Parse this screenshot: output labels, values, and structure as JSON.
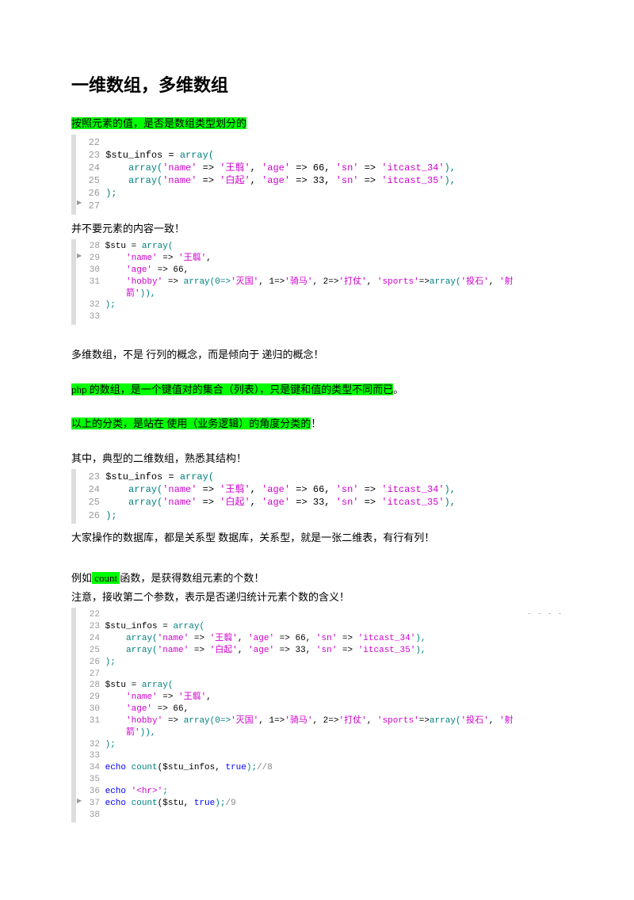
{
  "title": "一维数组，多维数组",
  "p1_hl": "按照元素的值，是否是数组类型划分的",
  "code1": {
    "l22": "22",
    "l23a": "23",
    "l23b": "$stu_infos = ",
    "l23c": "array",
    "l23d": "(",
    "l24a": "24",
    "l24b": "array",
    "l24c": "(",
    "l24d": "'name'",
    "l24e": " => ",
    "l24f": "'王翦'",
    "l24g": ", ",
    "l24h": "'age'",
    "l24i": " => 66, ",
    "l24j": "'sn'",
    "l24k": " => ",
    "l24l": "'itcast_34'",
    "l24m": "),",
    "l25a": "25",
    "l25b": "array",
    "l25c": "(",
    "l25d": "'name'",
    "l25e": " => ",
    "l25f": "'白起'",
    "l25g": ", ",
    "l25h": "'age'",
    "l25i": " => 33, ",
    "l25j": "'sn'",
    "l25k": " => ",
    "l25l": "'itcast_35'",
    "l25m": "),",
    "l26a": "26",
    "l26b": ");",
    "l27": "27"
  },
  "p2": "并不要元素的内容一致！",
  "code2": {
    "l28a": "28",
    "l28b": "$stu = ",
    "l28c": "array",
    "l28d": "(",
    "l29a": "29",
    "l29b": "'name'",
    "l29c": " => ",
    "l29d": "'王翦'",
    "l29e": ",",
    "l30a": "30",
    "l30b": "'age'",
    "l30c": " => 66,",
    "l31a": "31",
    "l31b": "'hobby'",
    "l31c": " => ",
    "l31d": "array",
    "l31e": "(0=>",
    "l31f": "'灭国'",
    "l31g": ", 1=>",
    "l31h": "'骑马'",
    "l31i": ", 2=>",
    "l31j": "'打仗'",
    "l31k": ", ",
    "l31l": "'sports'",
    "l31m": "=>",
    "l31n": "array",
    "l31o": "(",
    "l31p": "'投石'",
    "l31q": ", ",
    "l31r": "'射",
    "l31s": "箭'",
    "l31t": ")),",
    "l32a": "32",
    "l32b": ");",
    "l33": "33"
  },
  "p3": "多维数组，不是 行列的概念，而是倾向于 递归的概念！",
  "p4a": "php",
  "p4b": " 的数组，是一个键值对的集合（列表），只是键和值的类型不同而已",
  "p4c": "。",
  "p5a": "以上的分类，是站在 使用（业务逻辑）的角度分类的",
  "p5b": "！",
  "p6": "其中，典型的二维数组，熟悉其结构！",
  "p7": "大家操作的数据库，都是关系型 数据库，关系型，就是一张二维表，有行有列！",
  "p8a": "例如",
  "p8b": " count ",
  "p8c": "函数，是获得数组元素的个数！",
  "p9": "注意，接收第二个参数，表示是否递归统计元素个数的含义！",
  "code3": {
    "l22": "22",
    "l23": "23",
    "l24": "24",
    "l25": "25",
    "l26": "26",
    "l27": "27",
    "l28": "28",
    "l29": "29",
    "l30": "30",
    "l31": "31",
    "l32": "32",
    "l33": "33",
    "l34": "34",
    "l35": "35",
    "l36": "36",
    "l37": "37",
    "l38": "38",
    "t23a": "$stu_infos = ",
    "t23b": "array",
    "t23c": "(",
    "t24a": "array",
    "t24b": "(",
    "t24c": "'name'",
    "t24d": " => ",
    "t24e": "'王翦'",
    "t24f": ", ",
    "t24g": "'age'",
    "t24h": " => 66, ",
    "t24i": "'sn'",
    "t24j": " => ",
    "t24k": "'itcast_34'",
    "t24l": "),",
    "t25a": "array",
    "t25b": "(",
    "t25c": "'name'",
    "t25d": " => ",
    "t25e": "'白起'",
    "t25f": ", ",
    "t25g": "'age'",
    "t25h": " => 33, ",
    "t25i": "'sn'",
    "t25j": " => ",
    "t25k": "'itcast_35'",
    "t25l": "),",
    "t26": ");",
    "t28a": "$stu = ",
    "t28b": "array",
    "t28c": "(",
    "t29a": "'name'",
    "t29b": " => ",
    "t29c": "'王翦'",
    "t29d": ",",
    "t30a": "'age'",
    "t30b": " => 66,",
    "t31a": "'hobby'",
    "t31b": " => ",
    "t31c": "array",
    "t31d": "(0=>",
    "t31e": "'灭国'",
    "t31f": ", 1=>",
    "t31g": "'骑马'",
    "t31h": ", 2=>",
    "t31i": "'打仗'",
    "t31j": ", ",
    "t31k": "'sports'",
    "t31l": "=>",
    "t31m": "array",
    "t31n": "(",
    "t31o": "'投石'",
    "t31p": ", ",
    "t31q": "'射",
    "t31r": "箭'",
    "t31s": ")),",
    "t32": ");",
    "t34a": "echo ",
    "t34b": "count",
    "t34c": "($stu_infos, ",
    "t34d": "true",
    "t34e": ");",
    "t34f": "//8",
    "t36a": "echo ",
    "t36b": "'<hr>'",
    "t36c": ";",
    "t37a": "echo ",
    "t37b": "count",
    "t37c": "($stu, ",
    "t37d": "true",
    "t37e": ");",
    "t37f": "/9",
    "marker": "- - - -"
  }
}
